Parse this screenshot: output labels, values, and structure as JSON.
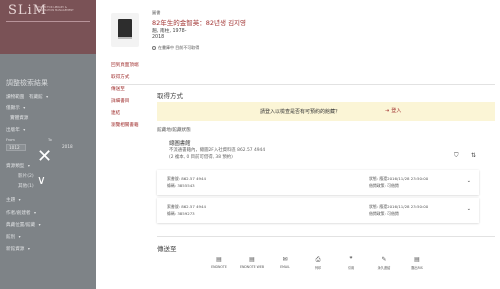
{
  "sidebar": {
    "logo": "SLiM",
    "logo_subtitle": "SYSTEM FOR LIBRARY & INFORMATION MANAGEMENT",
    "filter_title": "調整檢索結果",
    "filters": [
      {
        "label": "讀物範圍",
        "value": "有藏館"
      },
      {
        "label": "僅顯示",
        "value": ""
      },
      {
        "label": "實體資源",
        "value": ""
      },
      {
        "label": "出版年",
        "value": ""
      }
    ],
    "year_from_label": "From",
    "year_to_label": "To",
    "year_from": "1012",
    "year_to": "2018",
    "section2": [
      {
        "label": "資源類型"
      },
      {
        "label": "影片(2)"
      },
      {
        "label": "其他(1)"
      }
    ],
    "section3": [
      {
        "label": "主題"
      },
      {
        "label": "作者/創建者"
      },
      {
        "label": "典藏位置/館藏"
      },
      {
        "label": "館別"
      },
      {
        "label": "新館資源"
      }
    ]
  },
  "record": {
    "type": "圖書",
    "title": "82年生的金智英：82년생 김지영",
    "author": "趙, 南柱, 1978-",
    "year": "2018",
    "availability": "在書庫中 目前不可取得"
  },
  "nav": [
    "回到頁面頂端",
    "取得方式",
    "傳送至",
    "詳細書目",
    "連結",
    "瀏覽相關書籍"
  ],
  "get_it": {
    "title": "取得方式",
    "banner_text": "請登入以檢查是否有可預約的館藏？",
    "login_label": "登入",
    "location_label": "館藏地/館藏狀態",
    "library_name": "總圖書館",
    "library_detail": "不流通書籍內，總圖2F入社資料區 862.57 4944",
    "library_count": "(2 複本, 0 目前可借得, 38 預約)"
  },
  "items": [
    {
      "callno": "索書號: 862.57 4944",
      "barcode": "條碼: 3855543",
      "status": "狀態: 應還2016/11/28 23:50:00",
      "pickup": "借閱政策: 可借閱"
    },
    {
      "callno": "索書號: 862.57 4944",
      "barcode": "條碼: 3859273",
      "status": "狀態: 應還2016/11/28 23:50:00",
      "pickup": "借閱政策: 可借閱"
    }
  ],
  "send_to": {
    "title": "傳送至",
    "actions": [
      {
        "label": "ENDNOTE",
        "icon": "endnote-icon"
      },
      {
        "label": "ENDNOTE WEB",
        "icon": "endnote-web-icon"
      },
      {
        "label": "EMAIL",
        "icon": "email-icon"
      },
      {
        "label": "列印",
        "icon": "print-icon"
      },
      {
        "label": "引用",
        "icon": "quote-icon"
      },
      {
        "label": "永久連結",
        "icon": "permalink-icon"
      },
      {
        "label": "匯出RIS",
        "icon": "export-ris-icon"
      }
    ]
  },
  "colors": {
    "accent": "#a0302f",
    "banner": "#fbf5d6",
    "overlay": "#7e8387"
  }
}
